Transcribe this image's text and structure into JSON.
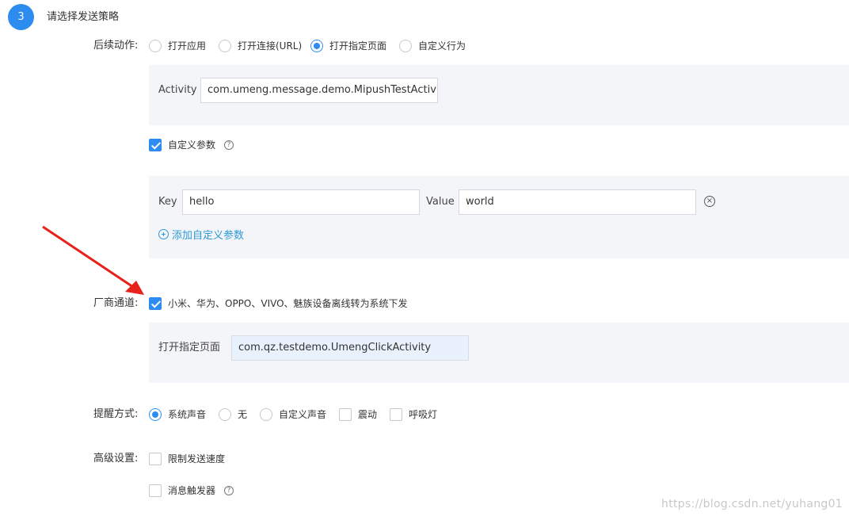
{
  "step": {
    "number": "3",
    "title": "请选择发送策略"
  },
  "follow_up": {
    "label": "后续动作:",
    "options": [
      {
        "label": "打开应用",
        "selected": false
      },
      {
        "label": "打开连接(URL)",
        "selected": false
      },
      {
        "label": "打开指定页面",
        "selected": true
      },
      {
        "label": "自定义行为",
        "selected": false
      }
    ],
    "activity_label": "Activity",
    "activity_value": "com.umeng.message.demo.MipushTestActivity"
  },
  "custom_params": {
    "checkbox_label": "自定义参数",
    "checked": true,
    "key_label": "Key",
    "key_value": "hello",
    "value_label": "Value",
    "value_value": "world",
    "add_label": "添加自定义参数"
  },
  "vendor_channel": {
    "label": "厂商通道:",
    "checked": true,
    "checkbox_label": "小米、华为、OPPO、VIVO、魅族设备离线转为系统下发",
    "page_label": "打开指定页面",
    "page_value": "com.qz.testdemo.UmengClickActivity"
  },
  "reminder": {
    "label": "提醒方式:",
    "options": [
      {
        "label": "系统声音",
        "type": "radio",
        "selected": true
      },
      {
        "label": "无",
        "type": "radio",
        "selected": false
      },
      {
        "label": "自定义声音",
        "type": "radio",
        "selected": false
      },
      {
        "label": "震动",
        "type": "checkbox",
        "selected": false
      },
      {
        "label": "呼吸灯",
        "type": "checkbox",
        "selected": false
      }
    ]
  },
  "advanced": {
    "label": "高级设置:",
    "limit_speed_label": "限制发送速度",
    "trigger_label": "消息触发器"
  },
  "watermark": "https://blog.csdn.net/yuhang01",
  "colors": {
    "accent": "#2d8cf0",
    "link": "#2d9ad8",
    "arrow": "#e8221b",
    "panel": "#f3f5f8"
  }
}
